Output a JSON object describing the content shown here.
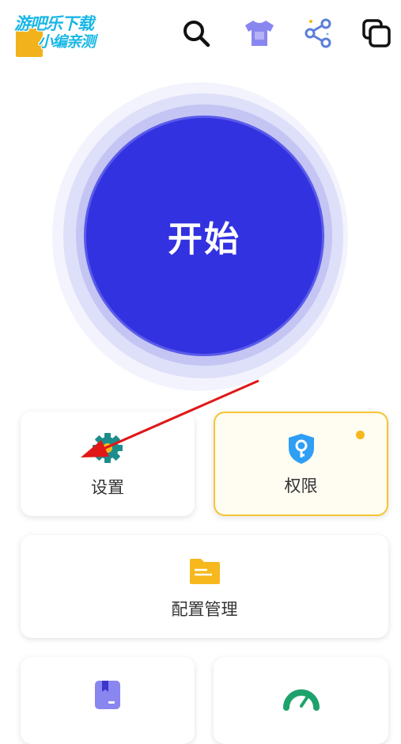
{
  "watermark": {
    "line1": "游吧乐下载",
    "line2": "小编亲测"
  },
  "toolbar": {
    "icons": [
      "search-icon",
      "tshirt-icon",
      "share-icon",
      "copy-icon"
    ],
    "colors": {
      "tshirt": "#8a86f0",
      "share": "#5b7fd8",
      "dark": "#111111"
    }
  },
  "start_button": {
    "label": "开始",
    "color": "#3232e0"
  },
  "cards": {
    "settings": {
      "label": "设置",
      "icon": "gear-icon",
      "icon_color": "#1d8d8c"
    },
    "permissions": {
      "label": "权限",
      "icon": "shield-key-icon",
      "icon_color": "#2f9ef5",
      "badge": "notification-dot",
      "badge_color": "#f6b81c"
    },
    "config": {
      "label": "配置管理",
      "icon": "folder-icon",
      "icon_color": "#f6b81c"
    },
    "bottom_left": {
      "label": "",
      "icon": "bookmark-icon",
      "icon_color": "#8a86f0"
    },
    "bottom_right": {
      "label": "",
      "icon": "speedometer-icon",
      "icon_color": "#1ea26b"
    }
  },
  "annotation": {
    "type": "red-arrow",
    "color": "#e01818",
    "points_to": "设置"
  }
}
